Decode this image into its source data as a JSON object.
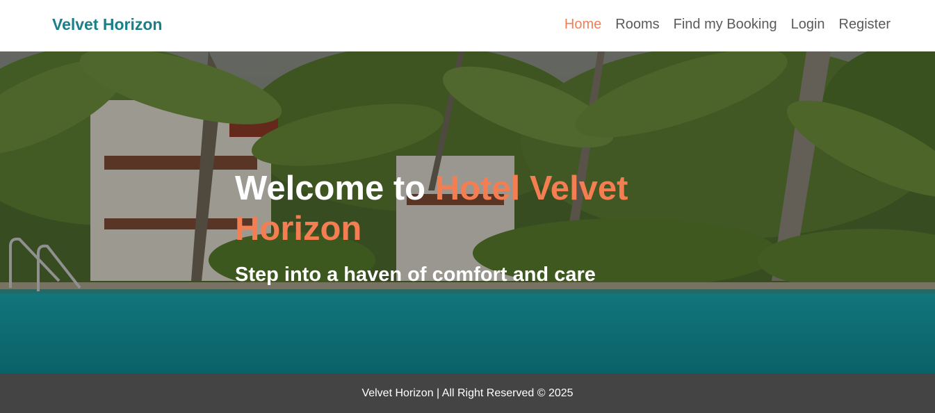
{
  "navbar": {
    "brand": "Velvet Horizon",
    "links": [
      {
        "label": "Home",
        "active": true
      },
      {
        "label": "Rooms",
        "active": false
      },
      {
        "label": "Find my Booking",
        "active": false
      },
      {
        "label": "Login",
        "active": false
      },
      {
        "label": "Register",
        "active": false
      }
    ]
  },
  "hero": {
    "title_prefix": "Welcome to ",
    "title_accent": "Hotel Velvet Horizon",
    "subtitle": "Step into a haven of comfort and care",
    "background_image": "tropical-resort-pool-image"
  },
  "footer": {
    "text": "Velvet Horizon | All Right Reserved © 2025"
  },
  "colors": {
    "brand": "#1a7f86",
    "accent": "#f47e52",
    "nav_text": "#5a5a5a",
    "footer_bg": "#444444"
  }
}
